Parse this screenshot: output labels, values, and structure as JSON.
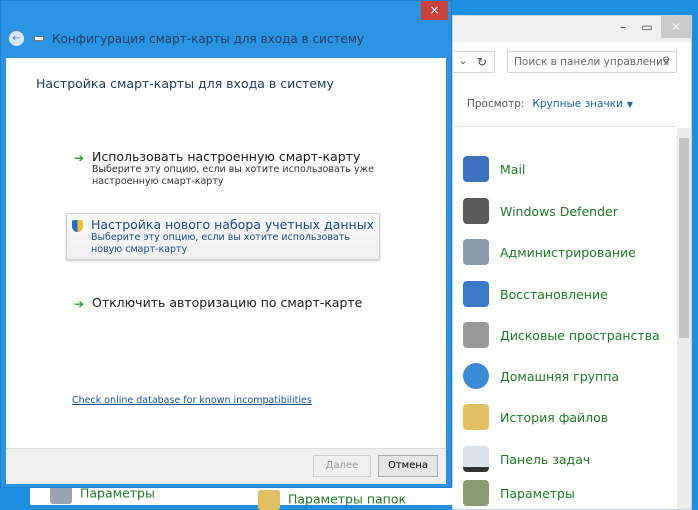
{
  "dialog": {
    "title": "Конфигурация смарт-карты для входа в систему",
    "heading": "Настройка смарт-карты для входа в систему",
    "options": [
      {
        "main": "Использовать настроенную смарт-карту",
        "sub": "Выберите эту опцию, если вы хотите использовать уже настроенную смарт-карту",
        "icon": "green-arrow-icon"
      },
      {
        "main": "Настройка нового набора учетных данных",
        "sub": "Выберите эту опцию, если вы хотите использовать новую смарт-карту",
        "icon": "uac-shield-icon",
        "selected": true
      },
      {
        "main": "Отключить авторизацию по смарт-карте",
        "sub": "",
        "icon": "green-arrow-icon"
      }
    ],
    "link": "Check online database for known incompatibilities",
    "next_label": "Далее",
    "next_disabled": true,
    "cancel_label": "Отмена",
    "close_glyph": "×"
  },
  "control_panel": {
    "search_placeholder": "Поиск в панели управления",
    "view_label": "Просмотр:",
    "view_value": "Крупные значки",
    "items": [
      "Mail",
      "Windows Defender",
      "Администрирование",
      "Восстановление",
      "Дисковые пространства",
      "Домашняя группа",
      "История файлов",
      "Панель задач",
      "Параметры"
    ],
    "bottom_items": [
      "Параметры",
      "Параметры папок"
    ]
  },
  "colors": {
    "desktop": "#1d8fe0",
    "accent_green": "#1e7a2a",
    "close_red": "#c8413c",
    "link": "#1a4f9c"
  }
}
